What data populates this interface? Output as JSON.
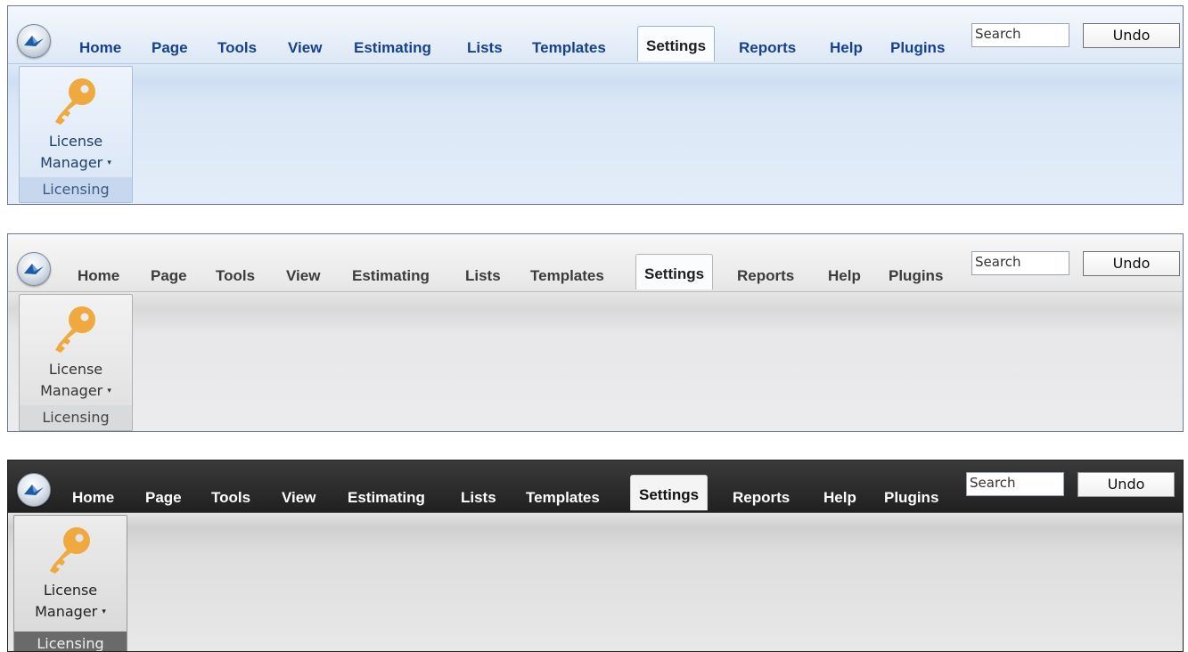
{
  "tabs": [
    "Home",
    "Page",
    "Tools",
    "View",
    "Estimating",
    "Lists",
    "Templates",
    "Settings",
    "Reports",
    "Help",
    "Plugins"
  ],
  "active_tab": "Settings",
  "search": {
    "placeholder": "Search"
  },
  "undo_label": "Undo",
  "license_button": {
    "line1": "License",
    "line2": "Manager",
    "caret": "▾"
  },
  "group_label": "Licensing",
  "icons": {
    "app_orb": "app-orb-icon",
    "key": "key-icon"
  },
  "themes": [
    {
      "name": "blue",
      "tab_text": "#15428b",
      "panel": "#e3edf9"
    },
    {
      "name": "silver",
      "tab_text": "#3b3b3b",
      "panel": "#ececee"
    },
    {
      "name": "dark",
      "tab_text": "#ffffff",
      "panel": "#e8e8e8"
    }
  ],
  "key_color": "#f0a93e"
}
